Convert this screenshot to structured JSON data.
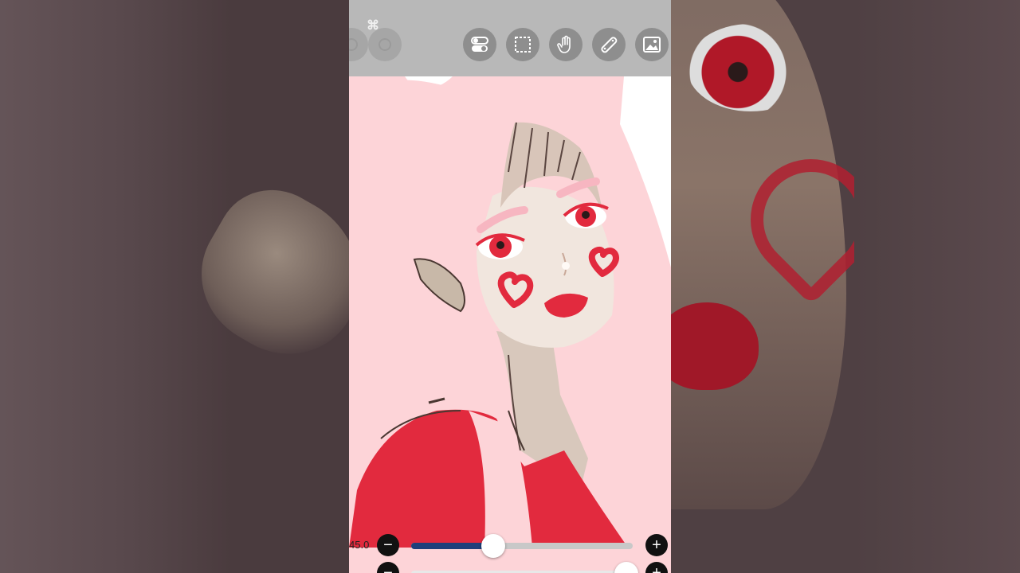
{
  "app": {
    "logo_text": "⌘"
  },
  "toolbar": {
    "buttons": [
      {
        "name": "toggle-icon"
      },
      {
        "name": "selection-icon"
      },
      {
        "name": "hand-icon"
      },
      {
        "name": "ruler-icon"
      },
      {
        "name": "image-icon"
      }
    ]
  },
  "sliders": {
    "size": {
      "value_label": "45.0",
      "fraction": 0.37
    },
    "opacity": {
      "value_label": "",
      "fraction": 0.97
    }
  },
  "colors": {
    "skin": "#f1e6de",
    "hair": "#fdd4d8",
    "accent_red": "#e22a3e",
    "slider_fill": "#1f3f7a"
  }
}
